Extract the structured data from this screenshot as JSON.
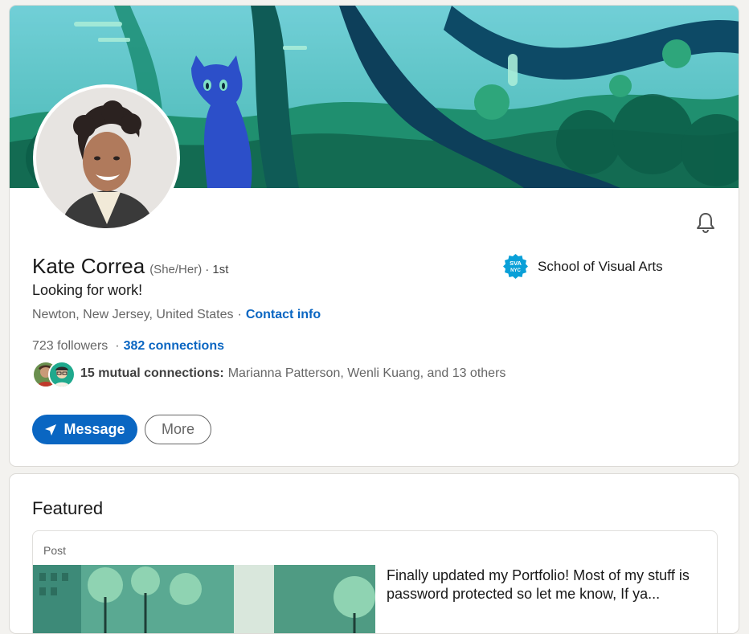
{
  "profile": {
    "name": "Kate Correa",
    "pronouns": "(She/Her)",
    "degree": "· 1st",
    "headline": "Looking for work!",
    "location": "Newton, New Jersey, United States",
    "location_sep": "·",
    "contact_info": "Contact info",
    "followers": "723 followers",
    "stats_sep": "·",
    "connections": "382 connections",
    "mutual_bold": "15 mutual connections:",
    "mutual_rest": "Marianna Patterson, Wenli Kuang, and 13 others",
    "school": "School of Visual Arts",
    "school_logo_text": "SVA NYC"
  },
  "actions": {
    "message_label": "Message",
    "more_label": "More"
  },
  "featured": {
    "title": "Featured",
    "post_label": "Post",
    "post_text": "Finally updated my Portfolio! Most of my stuff is password protected so let me know, If ya..."
  },
  "colors": {
    "accent": "#0a66c2",
    "background": "#f3f2ef",
    "school_logo": "#0aa0d8"
  },
  "icons": [
    "bell-icon",
    "send-icon",
    "school-logo-icon"
  ]
}
